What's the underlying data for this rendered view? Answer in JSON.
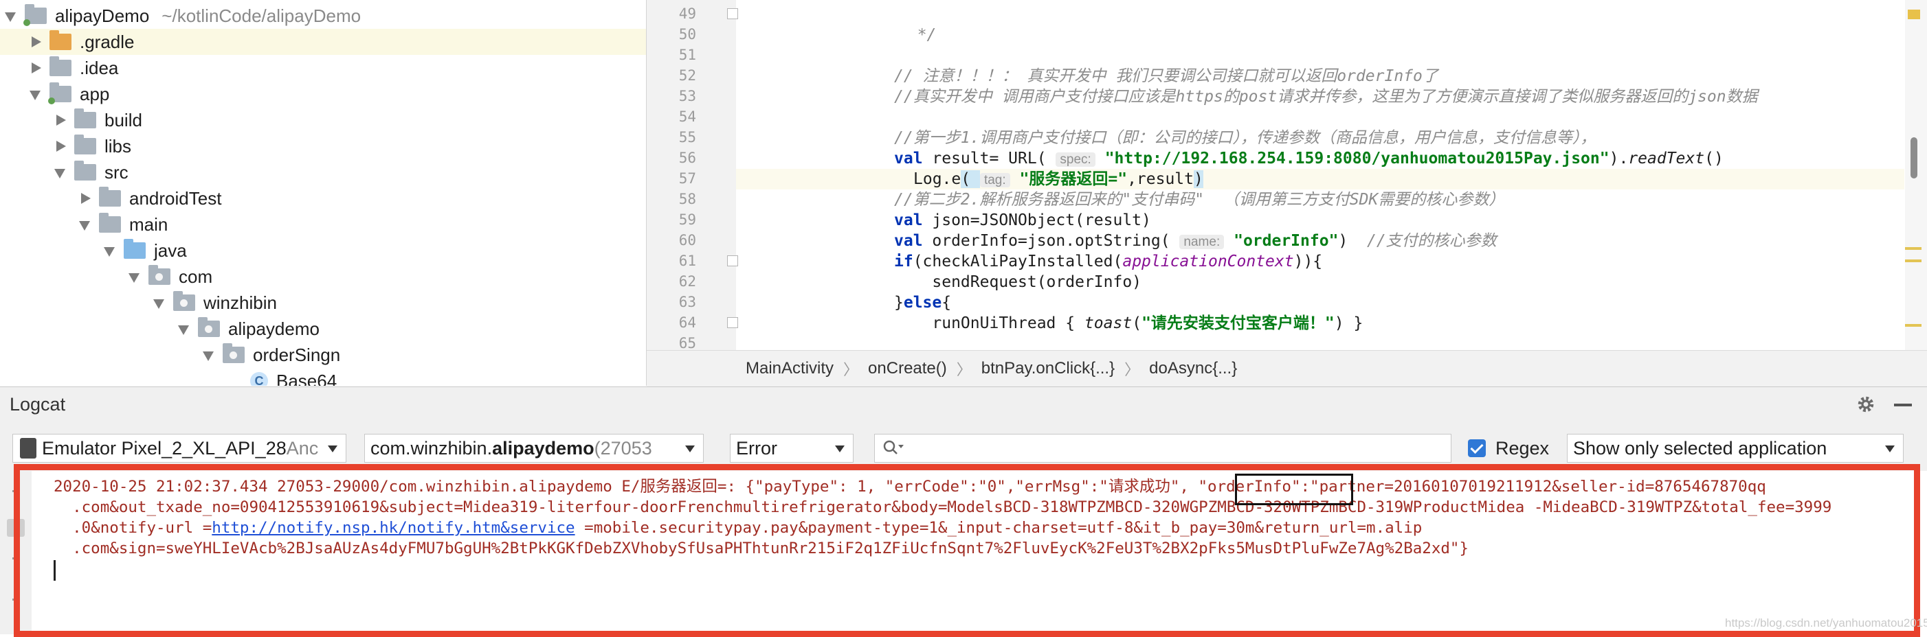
{
  "project_tree": {
    "root": {
      "name": "alipayDemo",
      "path": "~/kotlinCode/alipayDemo"
    },
    "items": [
      {
        "label": ".gradle"
      },
      {
        "label": ".idea"
      },
      {
        "label": "app"
      },
      {
        "label": "build"
      },
      {
        "label": "libs"
      },
      {
        "label": "src"
      },
      {
        "label": "androidTest"
      },
      {
        "label": "main"
      },
      {
        "label": "java"
      },
      {
        "label": "com"
      },
      {
        "label": "winzhibin"
      },
      {
        "label": "alipaydemo"
      },
      {
        "label": "orderSingn"
      },
      {
        "label": "Base64"
      }
    ]
  },
  "editor": {
    "line_numbers": [
      "49",
      "50",
      "51",
      "52",
      "53",
      "54",
      "55",
      "56",
      "57",
      "58",
      "59",
      "60",
      "61",
      "62",
      "63",
      "64",
      "65"
    ],
    "lines": {
      "l49": "*/",
      "l52_a": "// 注意！！！： 真实开发中 我们只要调公司接口就可以返回",
      "l52_b": "orderInfo",
      "l52_c": "了",
      "l53_a": "//真实开发中 调用商户支付接口应该是",
      "l53_b": "https",
      "l53_c": "的",
      "l53_d": "post",
      "l53_e": "请求并传参，这里为了方便演示直接调了类似服务器返回的",
      "l53_f": "json",
      "l53_g": "数据",
      "l55": "//第一步1.调用商户支付接口（即：公司的接口），传递参数（商品信息，用户信息，支付信息等），",
      "l56_kw": "val",
      "l56_a": " result= URL( ",
      "l56_hint": "spec:",
      "l56_str": "\"http://192.168.254.159:8080/yanhuomatou2015Pay.json\"",
      "l56_b": ").",
      "l56_fn": "readText",
      "l56_c": "()",
      "l57_a": "Log.e",
      "l57_b": "( ",
      "l57_hint": "tag:",
      "l57_str": "\"服务器返回=\"",
      "l57_c": ",result",
      "l57_d": ")",
      "l58_a": "//第二步2.解析服务器返回来的\"支付串码\"  （调用第三方支付",
      "l58_b": "SDK",
      "l58_c": "需要的核心参数）",
      "l59_kw": "val",
      "l59_a": " json=JSONObject(result)",
      "l60_kw": "val",
      "l60_a": " orderInfo=json.optString( ",
      "l60_hint": "name:",
      "l60_str": "\"orderInfo\"",
      "l60_b": ")  ",
      "l60_cm": "//支付的核心参数",
      "l61_kw": "if",
      "l61_a": "(checkAliPayInstalled(",
      "l61_pv": "applicationContext",
      "l61_b": ")){",
      "l62": "    sendRequest(orderInfo)",
      "l63_a": "}",
      "l63_kw": "else",
      "l63_b": "{",
      "l64_a": "    runOnUiThread { ",
      "l64_fn": "toast",
      "l64_b": "(",
      "l64_str": "\"请先安装支付宝客户端！\"",
      "l64_c": ") }"
    }
  },
  "breadcrumbs": [
    "MainActivity",
    "onCreate()",
    "btnPay.onClick{...}",
    "doAsync{...}"
  ],
  "breadcrumb_separator": "〉",
  "logcat": {
    "title": "Logcat",
    "device": {
      "name": "Emulator Pixel_2_XL_API_28",
      "suffix": " Anc"
    },
    "process": {
      "prefix": "com.winzhibin.",
      "bold": "alipaydemo",
      "pid": " (27053"
    },
    "level": "Error",
    "search_value": "",
    "search_icon": "magnifier-with-dropdown-icon",
    "regex_label": "Regex",
    "regex_checked": true,
    "filter": "Show only selected application",
    "log_line1_a": "2020-10-25 21:02:37.434 27053-29000/com.winzhibin.alipaydemo E/服务器返回=: {\"payType\": 1, \"errCode\":\"0\",\"errMsg\":\"请求成功\", ",
    "log_line1_key": "\"orderInfo\"",
    "log_line1_b": ":\"partner=20160107019211912&seller-id=8765467870qq",
    "log_line2": "  .com&out_txade_no=090412553910619&subject=Midea319-literfour-doorFrenchmultirefrigerator&body=ModelsBCD-318WTPZMBCD-320WGPZMBCD-320WTPZmBCD-319WProductMidea -MideaBCD-319WTPZ&total_fee=3999",
    "log_line3_a": "  .0&notify-url =",
    "log_line3_link": "http://notify.nsp.hk/notify.htm&service",
    "log_line3_b": " =mobile.securitypay.pay&payment-type=1&_input-charset=utf-8&it_b_pay=30m&return_url=m.alip",
    "log_line4": "  .com&sign=sweYHLIeVAcb%2BJsaAUzAs4dyFMU7bGgUH%2BtPkKGKfDebZXVhobySfUsaPHThtunRr215iF2q1ZFiUcfnSqnt7%2FluvEycK%2FeU3T%2BX2pFks5MusDtPluFwZe7Ag%2Ba2xd\"}"
  },
  "watermark": "https://blog.csdn.net/yanhuomatou2015",
  "colors": {
    "highlight_frame": "#e8412c",
    "error_text": "#a12d24",
    "keyword": "#0033b3",
    "string": "#067d17"
  }
}
